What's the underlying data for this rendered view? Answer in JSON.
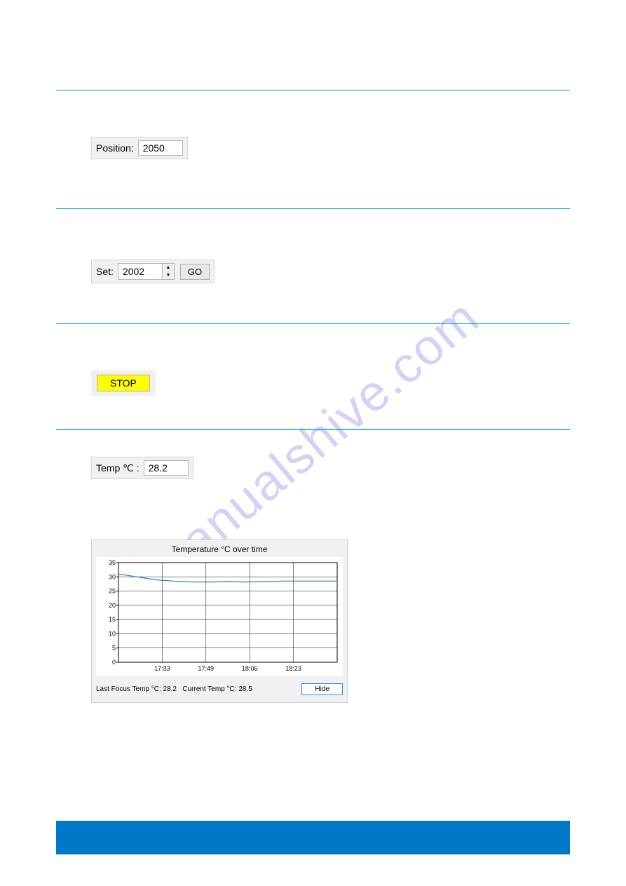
{
  "position_section": {
    "label": "Position:",
    "value": "2050"
  },
  "set_section": {
    "label": "Set:",
    "value": "2002",
    "go_label": "GO"
  },
  "stop_section": {
    "stop_label": "STOP"
  },
  "temp_section": {
    "label": "Temp ℃ :",
    "value": "28.2"
  },
  "chart": {
    "title": "Temperature °C over time",
    "last_focus_label": "Last Focus Temp °C:",
    "last_focus_value": "28.2",
    "current_label": "Current Temp  °C:",
    "current_value": "28.5",
    "hide_label": "Hide"
  },
  "chart_data": {
    "type": "line",
    "title": "Temperature °C over time",
    "xlabel": "",
    "ylabel": "",
    "ylim": [
      0,
      35
    ],
    "y_ticks": [
      0,
      5,
      10,
      15,
      20,
      25,
      30,
      35
    ],
    "x_ticks": [
      "17:33",
      "17:49",
      "18:06",
      "18:23"
    ],
    "series": [
      {
        "name": "Temperature",
        "x_time": [
          "17:20",
          "17:23",
          "17:26",
          "17:30",
          "17:33",
          "17:40",
          "17:49",
          "17:58",
          "18:06",
          "18:15",
          "18:23",
          "18:30",
          "18:36"
        ],
        "values": [
          31,
          30,
          29,
          28.5,
          28.2,
          28.2,
          28.3,
          28.2,
          28.3,
          28.5,
          28.5,
          28.5,
          28.5
        ]
      }
    ]
  },
  "watermark_text": "manualshive.com"
}
